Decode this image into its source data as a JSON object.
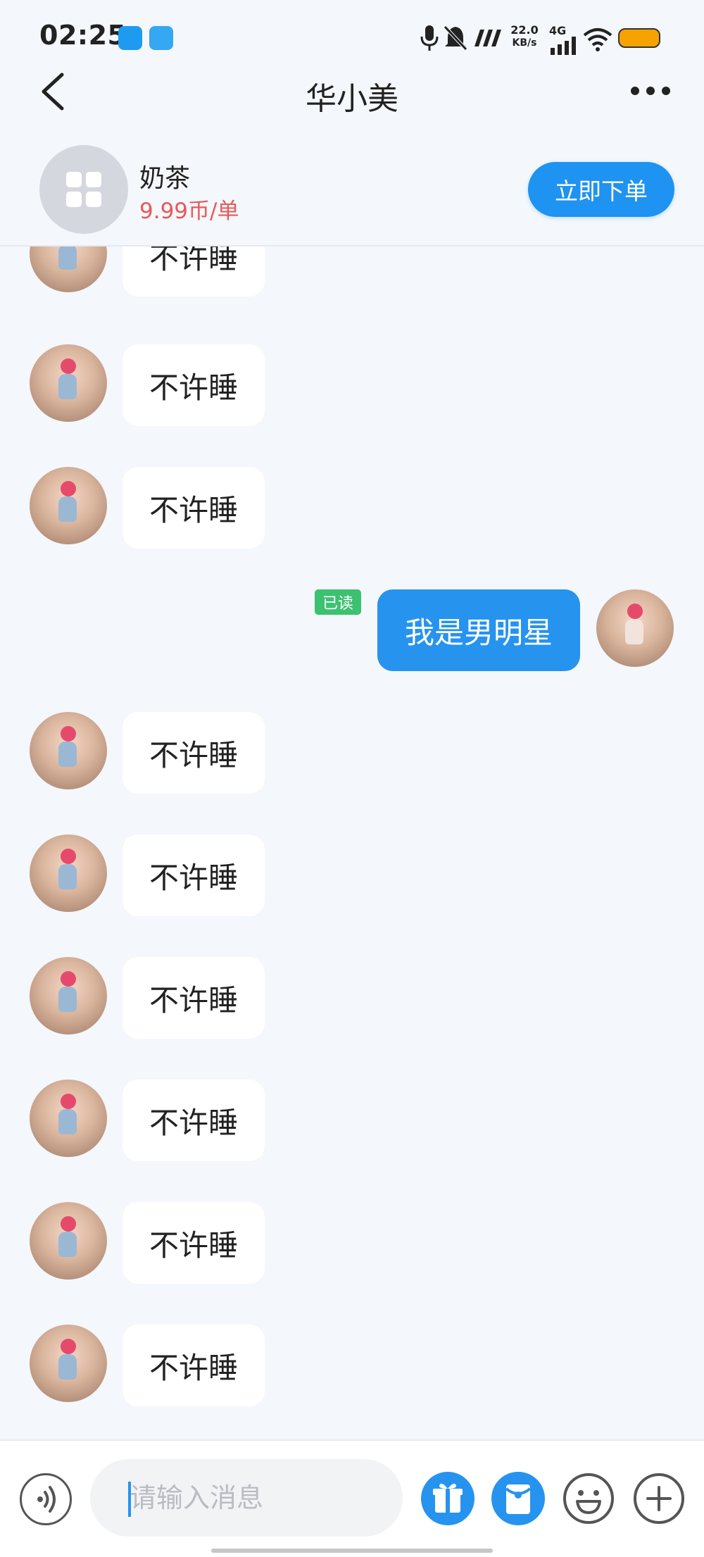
{
  "status": {
    "time": "02:25",
    "net_speed_value": "22.0",
    "net_speed_unit": "KB/s",
    "network": "4G"
  },
  "nav": {
    "title": "华小美"
  },
  "product": {
    "name": "奶茶",
    "price": "9.99币/单",
    "order_label": "立即下单"
  },
  "messages": [
    {
      "direction": "in",
      "text": "不许睡"
    },
    {
      "direction": "in",
      "text": "不许睡"
    },
    {
      "direction": "in",
      "text": "不许睡"
    },
    {
      "direction": "out",
      "text": "我是男明星",
      "read_label": "已读"
    },
    {
      "direction": "in",
      "text": "不许睡"
    },
    {
      "direction": "in",
      "text": "不许睡"
    },
    {
      "direction": "in",
      "text": "不许睡"
    },
    {
      "direction": "in",
      "text": "不许睡"
    },
    {
      "direction": "in",
      "text": "不许睡"
    },
    {
      "direction": "in",
      "text": "不许睡"
    }
  ],
  "input": {
    "placeholder": "请输入消息",
    "value": ""
  },
  "colors": {
    "accent": "#2693ef",
    "price": "#e65a5a",
    "read_badge": "#3cc171",
    "battery": "#f6a300"
  },
  "icons": {
    "back": "back-icon",
    "more": "more-icon",
    "voice": "voice-icon",
    "gift": "gift-icon",
    "red_packet": "red-packet-icon",
    "emoji": "emoji-icon",
    "plus": "plus-icon"
  }
}
